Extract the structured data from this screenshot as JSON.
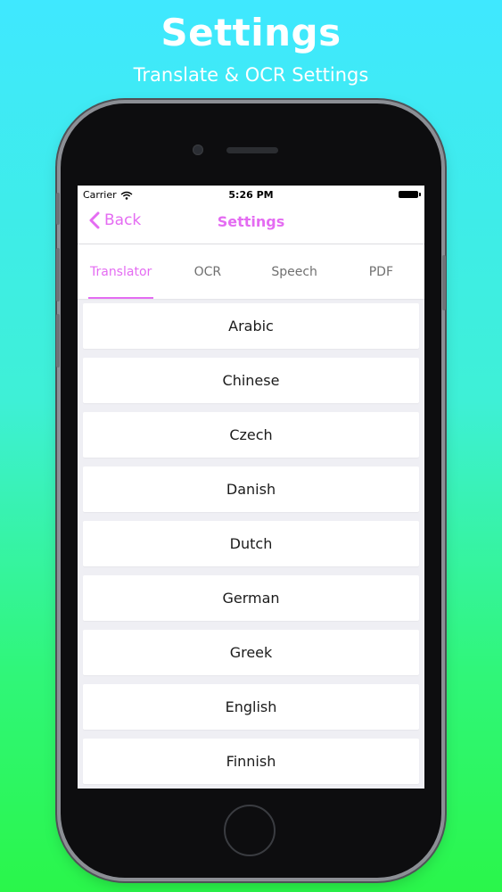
{
  "promo": {
    "title": "Settings",
    "subtitle": "Translate & OCR Settings"
  },
  "status_bar": {
    "carrier": "Carrier",
    "time": "5:26 PM",
    "icons": [
      "wifi-icon",
      "battery-icon"
    ]
  },
  "nav": {
    "back_label": "Back",
    "title": "Settings",
    "accent_color": "#e46cf2"
  },
  "tabs": [
    {
      "label": "Translator",
      "active": true
    },
    {
      "label": "OCR",
      "active": false
    },
    {
      "label": "Speech",
      "active": false
    },
    {
      "label": "PDF",
      "active": false
    }
  ],
  "languages": [
    "Arabic",
    "Chinese",
    "Czech",
    "Danish",
    "Dutch",
    "German",
    "Greek",
    "English",
    "Finnish"
  ]
}
